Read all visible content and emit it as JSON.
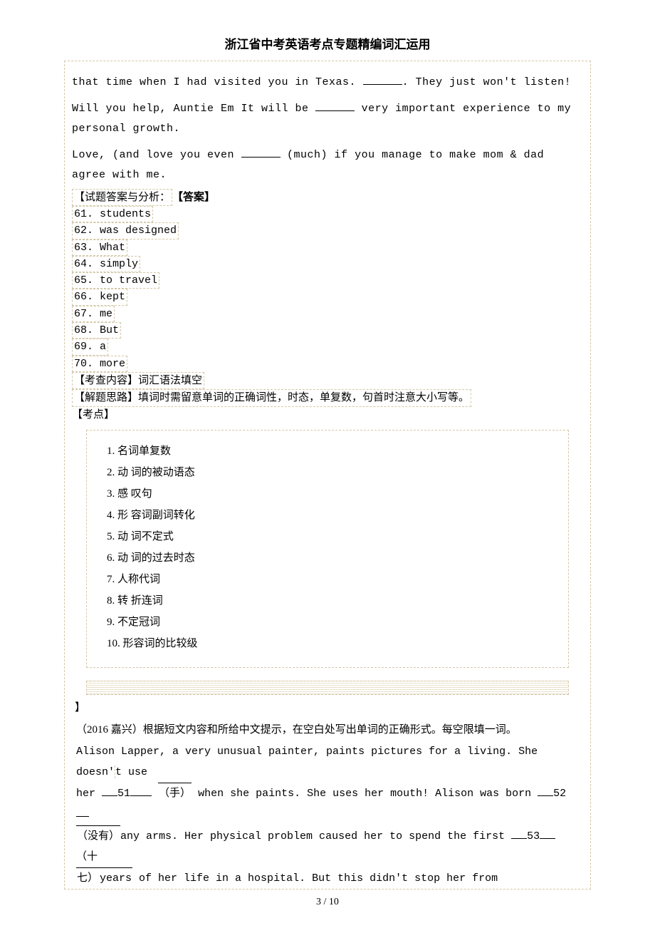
{
  "header": {
    "title": "浙江省中考英语考点专题精编词汇运用"
  },
  "passage1": {
    "p1_a": "that time when I had visited you in Texas. ",
    "p1_b": ". They just won't listen!",
    "p2_a": "Will you help, Auntie Em It will be ",
    "p2_b": " very important experience to my personal growth.",
    "p3_a": "Love, (and love you even ",
    "p3_b": " (much) if you manage to make mom & dad agree with me.",
    "analysis_label": "【试题答案与分析：",
    "answer_label": "【答案】",
    "answers": [
      "61. students",
      "62. was designed",
      "63. What",
      "64. simply",
      "65. to travel",
      "66. kept",
      "67. me",
      "68. But",
      "69. a",
      "70. more"
    ],
    "kc_label": "【考查内容】",
    "kc_text": "词汇语法填空",
    "jt_label": "【解题思路】",
    "jt_text": "填词时需留意单词的正确词性，时态，单复数，句首时注意大小写等。",
    "kd_label": "【考点】",
    "kd_items": [
      "1.  名词单复数",
      "2.  动 词的被动语态",
      "3.  感 叹句",
      "4.  形 容词副词转化",
      "5.  动 词不定式",
      "6.  动 词的过去时态",
      "7.  人称代词",
      "8.  转 折连词",
      "9.  不定冠词",
      "10. 形容词的比较级"
    ]
  },
  "bracket_close": "】",
  "passage2": {
    "intro": "（2016 嘉兴）根据短文内容和所给中文提示，在空白处写出单词的正确形式。每空限填一词。",
    "line1a": "Alison Lapper, a very unusual painter, paints pictures for a living. She doesn'",
    "line1b": "t use",
    "line2a": "her  ",
    "gap51": "51",
    "hint51": "（手）",
    "line2b": "when she paints. She uses her mouth! Alison was born  ",
    "gap52": "52",
    "hint52": "（没有）",
    "line3a": "any arms. Her physical problem caused her to spend the first ",
    "gap53": "53",
    "hint53": " （十",
    "line4a": "七）",
    "line4word": "years",
    "line4b": " of her life in a hospital. But this didn't stop her from"
  },
  "page": {
    "num": "3 / 10"
  }
}
